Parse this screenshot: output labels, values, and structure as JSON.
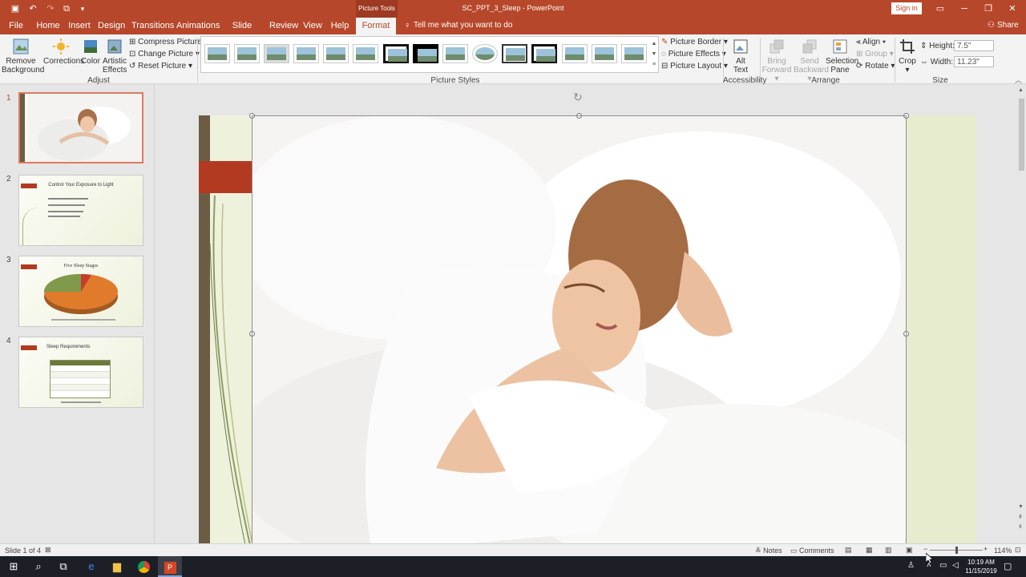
{
  "titlebar": {
    "context_tab": "Picture Tools",
    "doc_title": "SC_PPT_3_Sleep  -  PowerPoint",
    "signin": "Sign in",
    "share": "Share"
  },
  "tabs": [
    "File",
    "Home",
    "Insert",
    "Design",
    "Transitions",
    "Animations",
    "Slide Show",
    "Review",
    "View",
    "Help",
    "Format"
  ],
  "tell_me": "Tell me what you want to do",
  "ribbon": {
    "adjust": {
      "remove_bg_1": "Remove",
      "remove_bg_2": "Background",
      "corrections": "Corrections",
      "color": "Color",
      "artistic_1": "Artistic",
      "artistic_2": "Effects",
      "compress": "Compress Pictures",
      "change": "Change Picture",
      "reset": "Reset Picture",
      "label": "Adjust"
    },
    "styles": {
      "label": "Picture Styles",
      "border": "Picture Border",
      "effects": "Picture Effects",
      "layout": "Picture Layout"
    },
    "accessibility": {
      "alt_1": "Alt",
      "alt_2": "Text",
      "label": "Accessibility"
    },
    "arrange": {
      "bring_1": "Bring",
      "bring_2": "Forward",
      "send_1": "Send",
      "send_2": "Backward",
      "selection_1": "Selection",
      "selection_2": "Pane",
      "align": "Align",
      "group": "Group",
      "rotate": "Rotate",
      "label": "Arrange"
    },
    "size": {
      "crop": "Crop",
      "height_label": "Height:",
      "height_value": "7.5\"",
      "width_label": "Width:",
      "width_value": "11.23\"",
      "label": "Size"
    }
  },
  "slides": [
    {
      "num": "1",
      "title": ""
    },
    {
      "num": "2",
      "title": "Control Your Exposure to Light"
    },
    {
      "num": "3",
      "title": "Five Sleep Stages"
    },
    {
      "num": "4",
      "title": "Sleep Requirements"
    }
  ],
  "status": {
    "slide_of": "Slide 1 of 4",
    "notes": "Notes",
    "comments": "Comments",
    "zoom": "114%"
  },
  "taskbar": {
    "time": "10:19 AM",
    "date": "11/15/2019"
  },
  "colors": {
    "brand": "#b7472a",
    "slide_bg": "#eef2dc",
    "accent_bar": "#b23a20"
  }
}
